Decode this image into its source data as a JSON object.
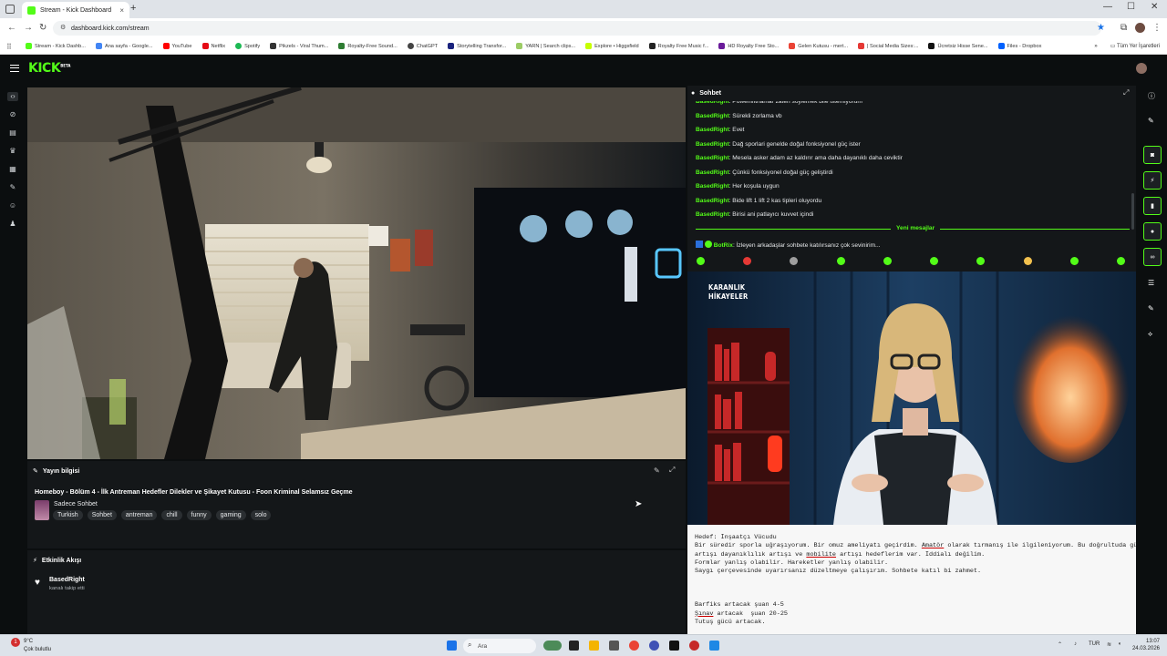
{
  "browser": {
    "tab_title": "Stream - Kick Dashboard",
    "tab_close": "×",
    "new_tab": "+",
    "url": "dashboard.kick.com/stream",
    "bookmarks": [
      {
        "label": "Stream - Kick Dashb...",
        "color": "#53fc18"
      },
      {
        "label": "Ana sayfa - Google...",
        "color": "#4285f4"
      },
      {
        "label": "YouTube",
        "color": "#ff0000"
      },
      {
        "label": "Netflix",
        "color": "#e50914"
      },
      {
        "label": "Spotify",
        "color": "#1db954"
      },
      {
        "label": "Pikzels - Viral Thum...",
        "color": "#333333"
      },
      {
        "label": "Royalty-Free Sound...",
        "color": "#2e7d32"
      },
      {
        "label": "ChatGPT",
        "color": "#444444"
      },
      {
        "label": "Storytelling Transfor...",
        "color": "#1a237e"
      },
      {
        "label": "YARN | Search clips...",
        "color": "#9ccc65"
      },
      {
        "label": "Explore • Higgsfield",
        "color": "#c6ff00"
      },
      {
        "label": "Royalty Free Music f...",
        "color": "#222222"
      },
      {
        "label": "HD Royalty Free Sto...",
        "color": "#6a1b9a"
      },
      {
        "label": "Gelen Kutusu - mert...",
        "color": "#ea4335"
      },
      {
        "label": "| Social Media Sizes:...",
        "color": "#e53935"
      },
      {
        "label": "Ücretsiz Hisse Sene...",
        "color": "#111111"
      },
      {
        "label": "Files - Dropbox",
        "color": "#0061fe"
      }
    ],
    "bookmarks_more": "»",
    "bookmarks_all": "Tüm Yer İşaretleri"
  },
  "kick": {
    "logo": "KICK",
    "logo_sup": "BETA"
  },
  "stream_info": {
    "header": "Yayın bilgisi",
    "title": "Homeboy - Bölüm 4 - İlk Antreman Hedefler Dilekler ve Şikayet Kutusu - Foon Kriminal Selamsız Geçme",
    "category": "Sadece Sohbet",
    "tags": [
      "Turkish",
      "Sohbet",
      "antreman",
      "chill",
      "funny",
      "gaming",
      "solo"
    ]
  },
  "activity": {
    "header": "Etkinlik Akışı",
    "user": "BasedRight",
    "action": "kanalı takip etti"
  },
  "chat": {
    "header": "Sohbet",
    "messages": [
      {
        "user": "BasedRight",
        "text": ": Powerlifitnamar zaten söylemek bile istemiyorum"
      },
      {
        "user": "BasedRight",
        "text": ": Sürekli zorlama vb"
      },
      {
        "user": "BasedRight",
        "text": ": Evet"
      },
      {
        "user": "BasedRight",
        "text": ": Dağ sporlari genelde doğal fonksiyonel güç ister"
      },
      {
        "user": "BasedRight",
        "text": ": Mesela asker adam az kaldırır ama daha dayanıklı daha ceviktir"
      },
      {
        "user": "BasedRight",
        "text": ": Çünkü fonksiyonel doğal güç geliştirdi"
      },
      {
        "user": "BasedRight",
        "text": ": Her koşula uygun"
      },
      {
        "user": "BasedRight",
        "text": ": Bide lift 1 lift 2 kas tipleri oluyordu"
      },
      {
        "user": "BasedRight",
        "text": ": Birisi ani patlayıcı kuvvet içindi"
      }
    ],
    "new_messages": "Yeni mesajlar",
    "bot_user": "BotRix",
    "bot_text": ": İzleyen arkadaşlar sohbete katılırsanız çok sevinirim..."
  },
  "overlay": {
    "brand_line1": "KARANLIK",
    "brand_line2": "HİKAYELER"
  },
  "notes": {
    "l1": "Hedef: İnşaatçı Vücudu",
    "l2a": "Bir süredir sporla uğraşıyorum. Bir omuz ameliyatı geçirdim. ",
    "l2b": "Amatör",
    "l2c": " olarak tırmanış ile ilgileniyorum. Bu doğrultuda güç",
    "l3a": "artışı dayanıklılık artışı ve ",
    "l3b": "mobilite",
    "l3c": " artışı hedeflerim var. İddialı değilim.",
    "l4": "Formlar yanlış olabilir. Hareketler yanlış olabilir.",
    "l5": "Saygı çerçevesinde uyarırsanız düzeltmeye çalışırım. Sohbete katıl bi zahmet.",
    "l6": "Barfiks artacak şuan 4-5",
    "l7a": "Şınav",
    "l7b": " artacak  şuan 20-25",
    "l8": "Tutuş gücü artacak."
  },
  "taskbar": {
    "weather_temp": "9°C",
    "weather_desc": "Çok bulutlu",
    "search_placeholder": "Ara",
    "lang": "TUR",
    "time": "13:07",
    "date": "24.03.2026",
    "notif_count": "1"
  }
}
